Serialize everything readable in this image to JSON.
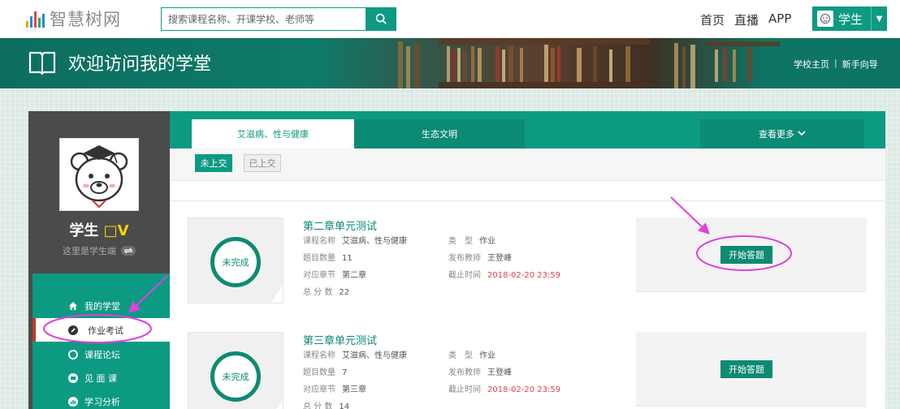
{
  "header": {
    "logo_text": "智慧树网",
    "search_placeholder": "搜索课程名称、开课学校、老师等",
    "nav": [
      "首页",
      "直播",
      "APP"
    ],
    "user_label": "学生"
  },
  "banner": {
    "title": "欢迎访问我的学堂",
    "links": [
      "学校主页",
      "|",
      "新手向导"
    ]
  },
  "sidebar": {
    "name": "学生",
    "vip_mark": "□V",
    "subtitle": "这里是学生端",
    "menu": [
      {
        "label": "我的学堂",
        "icon": "home-icon",
        "active": false
      },
      {
        "label": "作业考试",
        "icon": "pencil-icon",
        "active": true
      },
      {
        "label": "课程论坛",
        "icon": "forum-icon",
        "active": false
      },
      {
        "label": "见 面 课",
        "icon": "meeting-icon",
        "active": false
      },
      {
        "label": "学习分析",
        "icon": "analysis-icon",
        "active": false
      }
    ]
  },
  "tabs": {
    "course_1": "艾滋病、性与健康",
    "course_2": "生态文明",
    "more": "查看更多"
  },
  "filters": {
    "unsubmitted": "未上交",
    "submitted": "已上交"
  },
  "labels": {
    "course_name": "课程名称",
    "question_count": "题目数量",
    "chapter": "对应章节",
    "total_score": "总 分 数",
    "type": "类　型",
    "teacher": "发布教师",
    "deadline": "截止时间",
    "start": "开始答题"
  },
  "exams": [
    {
      "title": "第二章单元测试",
      "status": "未完成",
      "course_name": "艾滋病、性与健康",
      "question_count": "11",
      "chapter": "第二章",
      "total_score": "22",
      "type": "作业",
      "teacher": "王登峰",
      "deadline": "2018-02-20 23:59"
    },
    {
      "title": "第三章单元测试",
      "status": "未完成",
      "course_name": "艾滋病、性与健康",
      "question_count": "7",
      "chapter": "第三章",
      "total_score": "14",
      "type": "作业",
      "teacher": "王登峰",
      "deadline": "2018-02-20 23:59"
    }
  ],
  "colors": {
    "accent": "#0d9a83",
    "deadline": "#e0424b",
    "annotation": "#e040e0"
  }
}
